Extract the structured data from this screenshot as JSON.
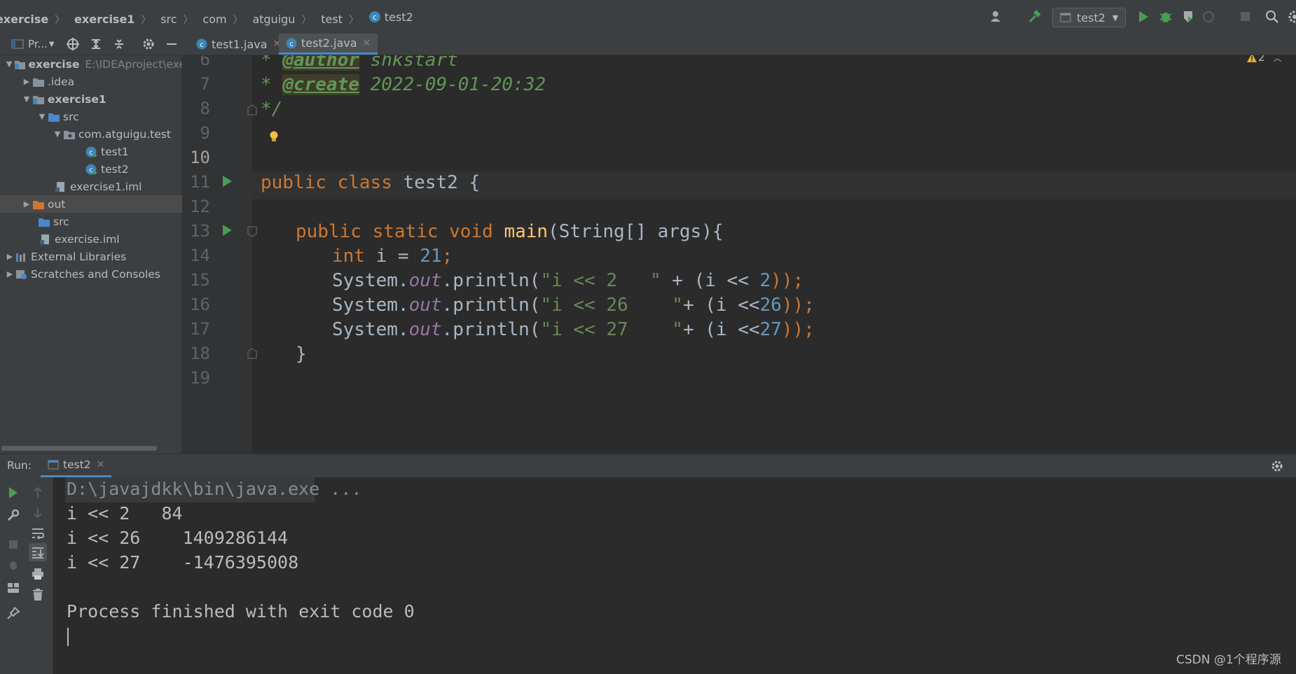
{
  "breadcrumbs": [
    "exercise",
    "exercise1",
    "src",
    "com",
    "atguigu",
    "test",
    "test2"
  ],
  "toolbar": {
    "run_config": "test2"
  },
  "project_panel": {
    "title": "Pr..."
  },
  "editor_tabs": [
    {
      "label": "test1.java",
      "active": false
    },
    {
      "label": "test2.java",
      "active": true
    }
  ],
  "tree": [
    {
      "label": "exercise",
      "hint": "E:\\IDEAproject\\exe",
      "depth": 0,
      "expanded": true,
      "bold": true
    },
    {
      "label": ".idea",
      "depth": 1,
      "expanded": false
    },
    {
      "label": "exercise1",
      "depth": 1,
      "expanded": true,
      "bold": true
    },
    {
      "label": "src",
      "depth": 2,
      "expanded": true
    },
    {
      "label": "com.atguigu.test",
      "depth": 3,
      "expanded": true
    },
    {
      "label": "test1",
      "depth": 4
    },
    {
      "label": "test2",
      "depth": 4
    },
    {
      "label": "exercise1.iml",
      "depth": 3
    },
    {
      "label": "out",
      "depth": 1,
      "expanded": false
    },
    {
      "label": "src",
      "depth": 1
    },
    {
      "label": "exercise.iml",
      "depth": 1
    },
    {
      "label": "External Libraries",
      "depth": 0,
      "expanded": false
    },
    {
      "label": "Scratches and Consoles",
      "depth": 0,
      "expanded": false
    }
  ],
  "editor": {
    "warnings_count": "2",
    "line_numbers": [
      "6",
      "7",
      "8",
      "9",
      "10",
      "11",
      "12",
      "13",
      "14",
      "15",
      "16",
      "17",
      "18",
      "19"
    ],
    "code": {
      "l6_star": "* ",
      "l6_tag": "@author",
      "l6_val": " shkstart",
      "l7_star": "* ",
      "l7_tag": "@create",
      "l7_val": " 2022-09-01-20:32",
      "l8": "*/",
      "l11_kw1": "public",
      "l11_kw2": "class",
      "l11_name": "test2",
      "l11_brace": "{",
      "l13_kw1": "public",
      "l13_kw2": "static",
      "l13_kw3": "void",
      "l13_fn": "main",
      "l13_rest": "(String[] args){",
      "l14_kw": "int",
      "l14_mid": " i = ",
      "l14_num": "21",
      "l14_end": ";",
      "sys": "System.",
      "out": "out",
      "println": ".println(",
      "l15_str": "\"i << 2   \"",
      "l15_mid": " + (i << ",
      "l15_num": "2",
      "l15_end": "));",
      "l16_str": "\"i << 26    \"",
      "l16_mid": "+ (i <<",
      "l16_num": "26",
      "l16_end": "));",
      "l17_str": "\"i << 27    \"",
      "l17_mid": "+ (i <<",
      "l17_num": "27",
      "l17_end": "));",
      "l18": "}"
    }
  },
  "run_panel": {
    "label": "Run:",
    "tab": "test2",
    "console": [
      "D:\\javajdkk\\bin\\java.exe ...",
      "i << 2   84",
      "i << 26    1409286144",
      "i << 27    -1476395008",
      "",
      "Process finished with exit code 0"
    ]
  },
  "watermark": "CSDN @1个程序源",
  "colors": {
    "accent": "#4a88c7",
    "run_green": "#499c54",
    "keyword": "#cc7832",
    "number": "#6897bb",
    "string": "#6a8759"
  }
}
